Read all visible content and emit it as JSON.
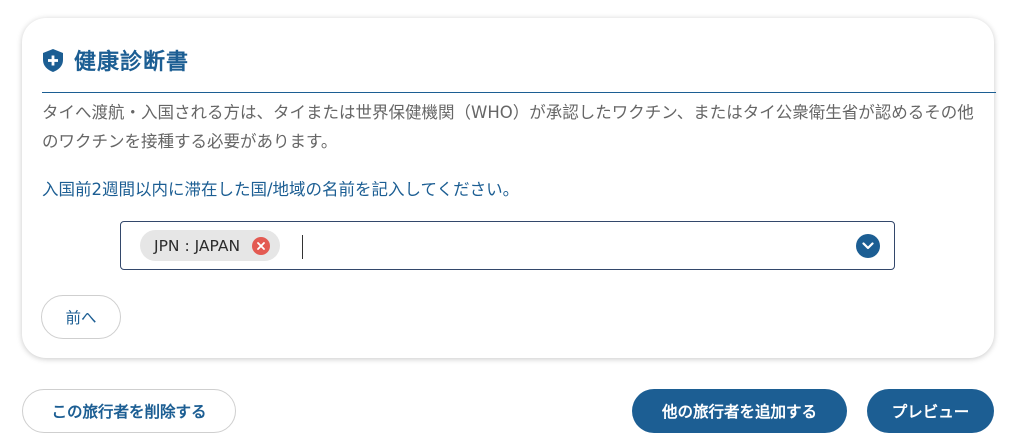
{
  "card": {
    "title": "健康診断書",
    "description": "タイへ渡航・入国される方は、タイまたは世界保健機関（WHO）が承認したワクチン、またはタイ公衆衛生省が認めるその他のワクチンを接種する必要があります。",
    "instruction": "入国前2週間以内に滞在した国/地域の名前を記入してください。",
    "country_select": {
      "selected": [
        "JPN : JAPAN"
      ],
      "input_value": ""
    },
    "prev_label": "前へ"
  },
  "footer": {
    "remove_traveler_label": "この旅行者を削除する",
    "add_traveler_label": "他の旅行者を追加する",
    "preview_label": "プレビュー"
  },
  "icons": {
    "title_icon": "shield-plus-icon",
    "chip_remove": "close-circle-icon",
    "dropdown": "chevron-down-icon"
  },
  "colors": {
    "primary": "#1c5e93",
    "text_muted": "#666666",
    "chip_bg": "#e6e6e6",
    "chip_remove": "#e35a52",
    "select_border": "#33476b"
  }
}
